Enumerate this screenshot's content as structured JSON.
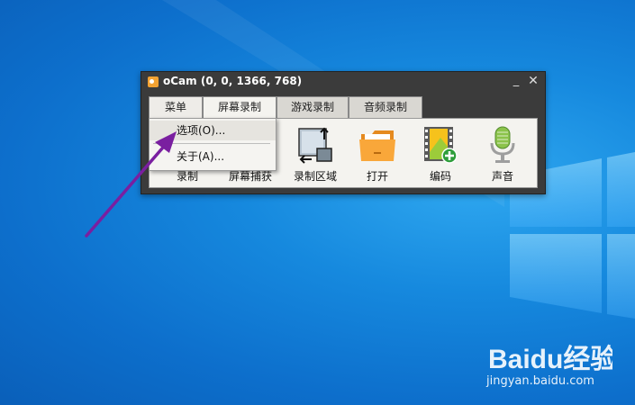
{
  "window": {
    "title": "oCam (0, 0, 1366, 768)",
    "minimize_glyph": "_",
    "close_glyph": "✕"
  },
  "tabs": [
    {
      "label": "菜单"
    },
    {
      "label": "屏幕录制"
    },
    {
      "label": "游戏录制"
    },
    {
      "label": "音频录制"
    }
  ],
  "tools": [
    {
      "label": "录制",
      "icon": "record-icon"
    },
    {
      "label": "屏幕捕获",
      "icon": "capture-icon"
    },
    {
      "label": "录制区域",
      "icon": "resize-region-icon"
    },
    {
      "label": "打开",
      "icon": "folder-icon"
    },
    {
      "label": "编码",
      "icon": "film-add-icon"
    },
    {
      "label": "声音",
      "icon": "microphone-icon"
    }
  ],
  "menu": {
    "items": [
      {
        "label": "选项(O)..."
      },
      {
        "label": "关于(A)..."
      }
    ]
  },
  "watermark": {
    "logo": "Baidu经验",
    "url": "jingyan.baidu.com"
  },
  "colors": {
    "desktop": "#0d6fcc",
    "arrow": "#7a1fa0",
    "window_frame": "#3b3b3b",
    "panel": "#f4f3ef"
  }
}
